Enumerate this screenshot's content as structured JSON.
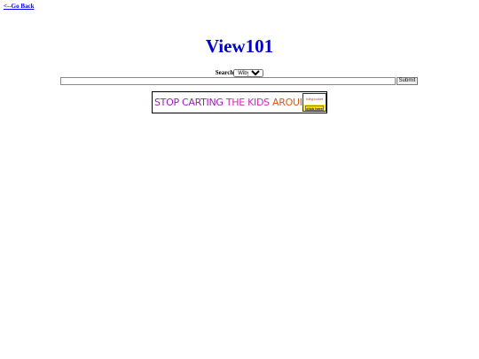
{
  "nav": {
    "back_label": "<--Go Back"
  },
  "header": {
    "title": "View101"
  },
  "search": {
    "label": "Search",
    "selected_option": "Wiby",
    "query_value": "",
    "submit_label": "Submit"
  },
  "banner": {
    "text_part1": "STOP CARTING ",
    "text_part2": "THE KIDS ",
    "text_part3": "AROUND.",
    "logo_text": "rollypocket",
    "logo_button": "click here"
  },
  "colors": {
    "link": "#0000ee",
    "title": "#0000cc"
  }
}
